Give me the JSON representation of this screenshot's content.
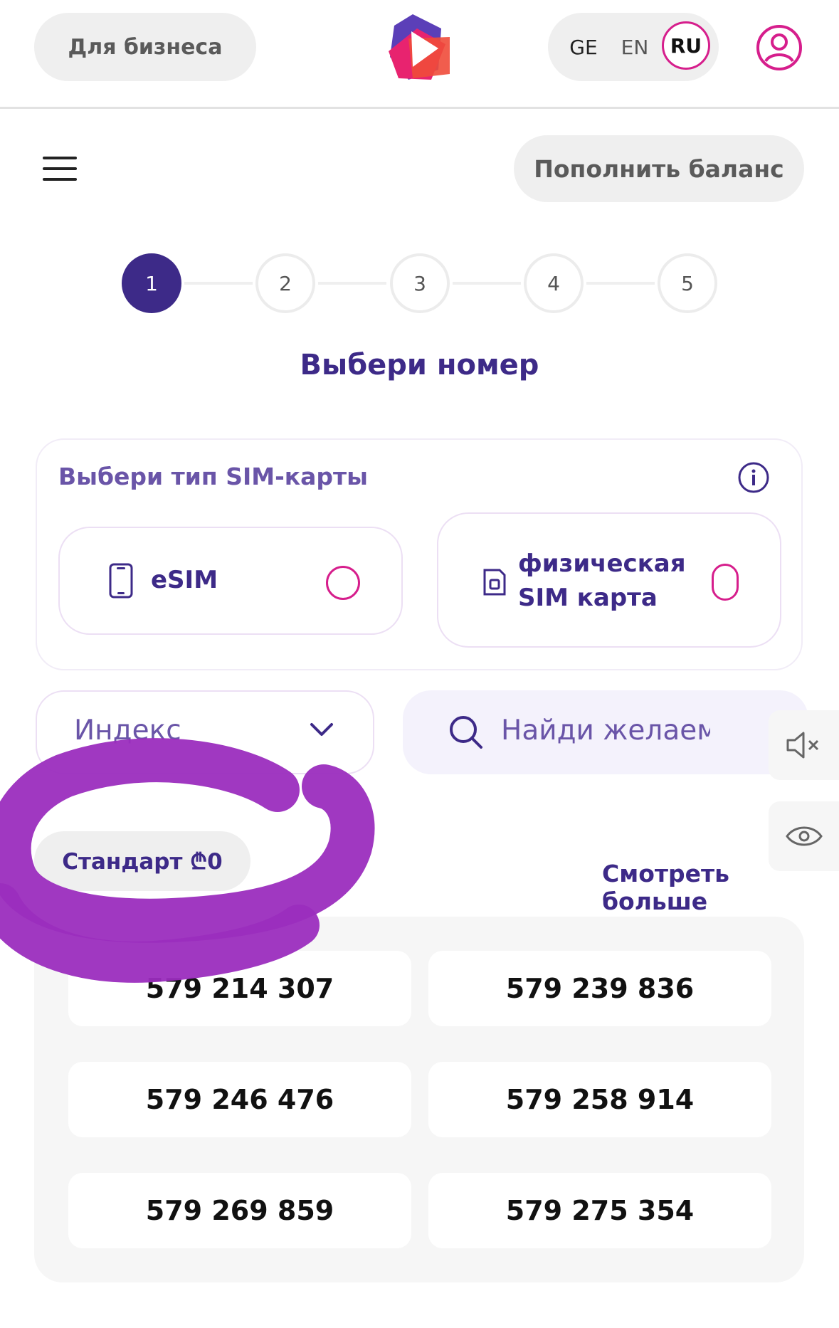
{
  "header": {
    "business_label": "Для бизнеса",
    "languages": [
      "GE",
      "EN",
      "RU"
    ],
    "active_language": "RU",
    "topup_label": "Пополнить баланс"
  },
  "steps": [
    "1",
    "2",
    "3",
    "4",
    "5"
  ],
  "active_step": "1",
  "page_title": "Выбери номер",
  "sim": {
    "type_label": "Выбери тип SIM-карты",
    "options": [
      {
        "label": "eSIM",
        "icon": "phone-icon"
      },
      {
        "label": "физическая SIM карта",
        "icon": "sim-card-icon"
      }
    ]
  },
  "filters": {
    "index_label": "Индекс",
    "search_placeholder": "Найди желаемый номер"
  },
  "category": {
    "tab_label": "Стандарт ₾0",
    "see_more": "Смотреть больше"
  },
  "numbers": [
    "579 214 307",
    "579 239 836",
    "579 246 476",
    "579 258 914",
    "579 269 859",
    "579 275 354"
  ],
  "colors": {
    "brand_purple": "#3d2a88",
    "accent_pink": "#d61e8c",
    "scribble": "#9b2dbe"
  }
}
